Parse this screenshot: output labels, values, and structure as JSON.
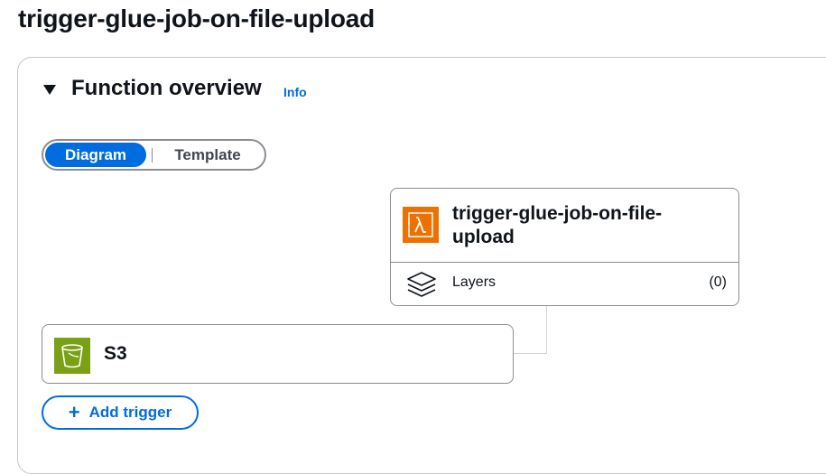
{
  "page": {
    "title": "trigger-glue-job-on-file-upload"
  },
  "overview": {
    "title": "Function overview",
    "info_link": "Info",
    "view_toggle": {
      "options": [
        "Diagram",
        "Template"
      ],
      "selected": "Diagram"
    }
  },
  "function_card": {
    "name": "trigger-glue-job-on-file-upload",
    "icon": "lambda-icon",
    "icon_color": "#ed7100",
    "layers": {
      "label": "Layers",
      "count": "(0)",
      "icon": "layers-icon"
    }
  },
  "trigger_card": {
    "name": "S3",
    "icon": "s3-bucket-icon",
    "icon_color": "#7aa116"
  },
  "actions": {
    "add_trigger": "Add trigger"
  },
  "colors": {
    "accent": "#006ce0",
    "text": "#0f141a",
    "border": "#8c8c94"
  }
}
